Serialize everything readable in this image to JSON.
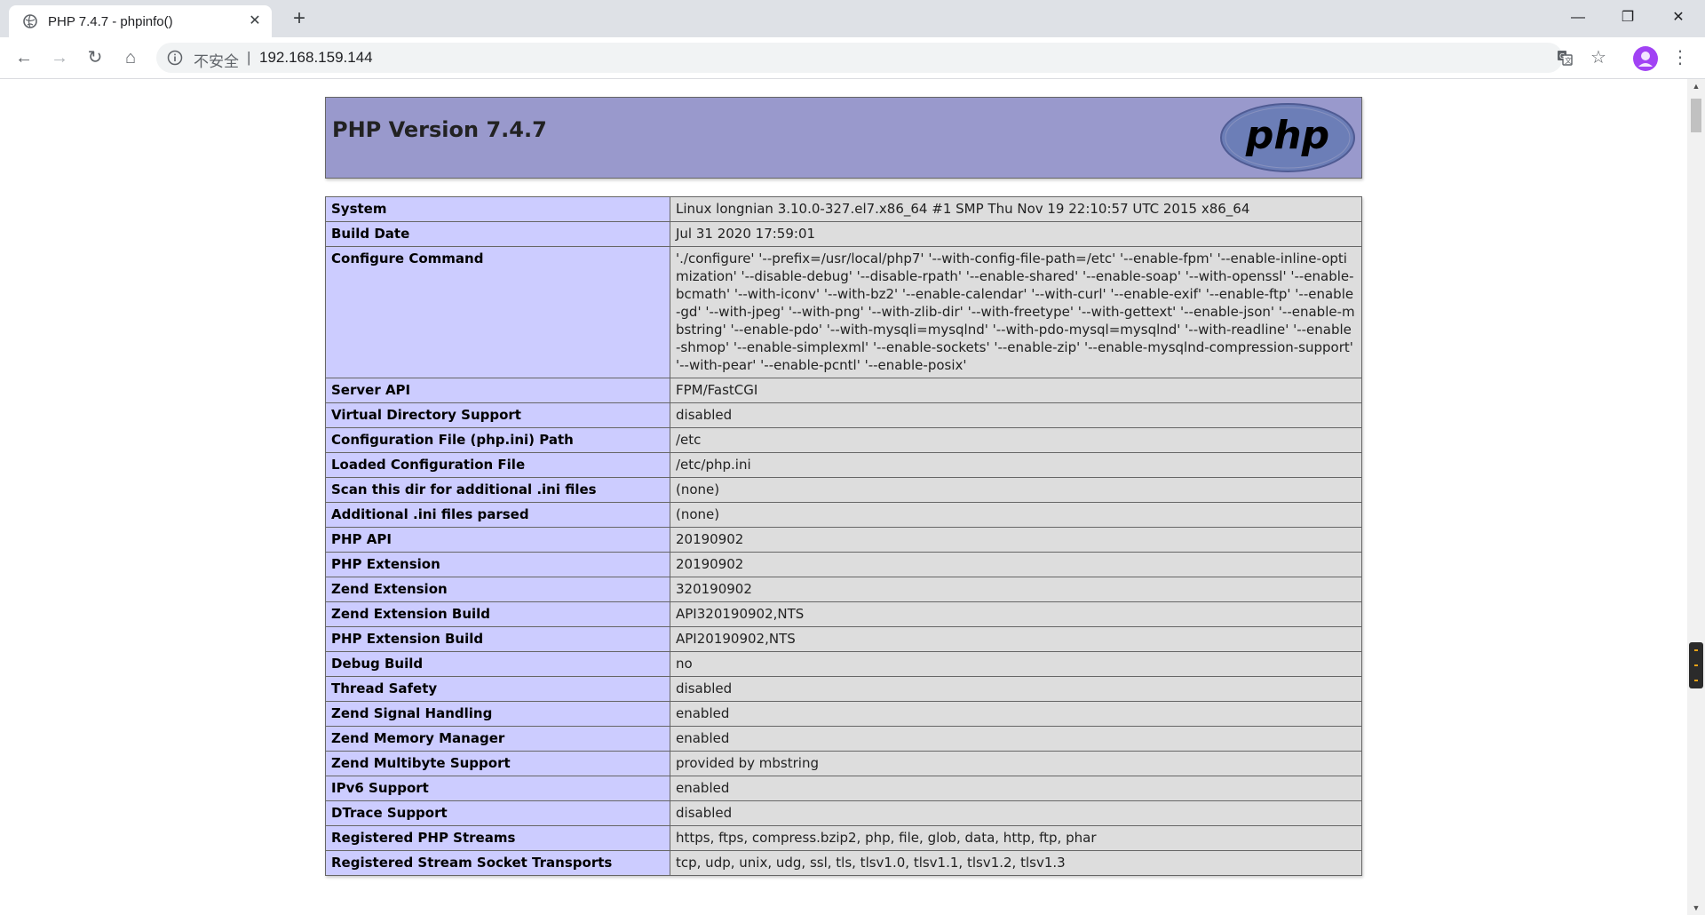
{
  "tab": {
    "title": "PHP 7.4.7 - phpinfo()",
    "close_glyph": "✕",
    "new_tab_glyph": "+"
  },
  "window_controls": {
    "minimize": "—",
    "restore": "❐",
    "close": "✕"
  },
  "toolbar": {
    "back": "←",
    "forward": "→",
    "reload": "↻",
    "home": "⌂",
    "menu": "⋮"
  },
  "omnibox": {
    "security_label": "不安全",
    "separator": "|",
    "url": "192.168.159.144",
    "translate_icon": "translate-icon",
    "bookmark_glyph": "☆"
  },
  "page": {
    "version_title": "PHP Version 7.4.7",
    "logo_text": "php",
    "rows": [
      {
        "key": "System",
        "value": "Linux longnian 3.10.0-327.el7.x86_64 #1 SMP Thu Nov 19 22:10:57 UTC 2015 x86_64"
      },
      {
        "key": "Build Date",
        "value": "Jul 31 2020 17:59:01"
      },
      {
        "key": "Configure Command",
        "value": "'./configure' '--prefix=/usr/local/php7' '--with-config-file-path=/etc' '--enable-fpm' '--enable-inline-optimization' '--disable-debug' '--disable-rpath' '--enable-shared' '--enable-soap' '--with-openssl' '--enable-bcmath' '--with-iconv' '--with-bz2' '--enable-calendar' '--with-curl' '--enable-exif' '--enable-ftp' '--enable-gd' '--with-jpeg' '--with-png' '--with-zlib-dir' '--with-freetype' '--with-gettext' '--enable-json' '--enable-mbstring' '--enable-pdo' '--with-mysqli=mysqlnd' '--with-pdo-mysql=mysqlnd' '--with-readline' '--enable-shmop' '--enable-simplexml' '--enable-sockets' '--enable-zip' '--enable-mysqlnd-compression-support' '--with-pear' '--enable-pcntl' '--enable-posix'"
      },
      {
        "key": "Server API",
        "value": "FPM/FastCGI"
      },
      {
        "key": "Virtual Directory Support",
        "value": "disabled"
      },
      {
        "key": "Configuration File (php.ini) Path",
        "value": "/etc"
      },
      {
        "key": "Loaded Configuration File",
        "value": "/etc/php.ini"
      },
      {
        "key": "Scan this dir for additional .ini files",
        "value": "(none)"
      },
      {
        "key": "Additional .ini files parsed",
        "value": "(none)"
      },
      {
        "key": "PHP API",
        "value": "20190902"
      },
      {
        "key": "PHP Extension",
        "value": "20190902"
      },
      {
        "key": "Zend Extension",
        "value": "320190902"
      },
      {
        "key": "Zend Extension Build",
        "value": "API320190902,NTS"
      },
      {
        "key": "PHP Extension Build",
        "value": "API20190902,NTS"
      },
      {
        "key": "Debug Build",
        "value": "no"
      },
      {
        "key": "Thread Safety",
        "value": "disabled"
      },
      {
        "key": "Zend Signal Handling",
        "value": "enabled"
      },
      {
        "key": "Zend Memory Manager",
        "value": "enabled"
      },
      {
        "key": "Zend Multibyte Support",
        "value": "provided by mbstring"
      },
      {
        "key": "IPv6 Support",
        "value": "enabled"
      },
      {
        "key": "DTrace Support",
        "value": "disabled"
      },
      {
        "key": "Registered PHP Streams",
        "value": "https, ftps, compress.bzip2, php, file, glob, data, http, ftp, phar"
      },
      {
        "key": "Registered Stream Socket Transports",
        "value": "tcp, udp, unix, udg, ssl, tls, tlsv1.0, tlsv1.1, tlsv1.2, tlsv1.3"
      }
    ]
  },
  "colors": {
    "header_bg": "#9999cc",
    "key_cell_bg": "#ccccff",
    "value_cell_bg": "#dddddd",
    "tabstrip_bg": "#dee1e6",
    "avatar": "#a142f4"
  }
}
